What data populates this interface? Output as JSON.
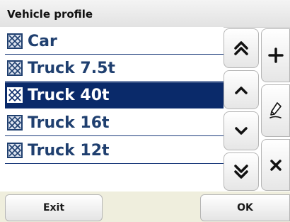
{
  "window": {
    "title": "Vehicle profile"
  },
  "vehicles": [
    {
      "label": "Car",
      "selected": false,
      "icon": "vehicle-profile-icon"
    },
    {
      "label": "Truck 7.5t",
      "selected": false,
      "icon": "vehicle-profile-icon"
    },
    {
      "label": "Truck 40t",
      "selected": true,
      "icon": "vehicle-profile-icon"
    },
    {
      "label": "Truck 16t",
      "selected": false,
      "icon": "vehicle-profile-icon"
    },
    {
      "label": "Truck 12t",
      "selected": false,
      "icon": "vehicle-profile-icon"
    }
  ],
  "scroll_buttons": {
    "page_up_icon": "double-chevron-up-icon",
    "up_icon": "chevron-up-icon",
    "down_icon": "chevron-down-icon",
    "page_down_icon": "double-chevron-down-icon"
  },
  "action_buttons": {
    "add_icon": "plus-icon",
    "edit_icon": "pen-icon",
    "delete_icon": "cross-icon"
  },
  "bottom_bar": {
    "exit_label": "Exit",
    "ok_label": "OK"
  },
  "colors": {
    "selection": "#0a2a6a",
    "item_text": "#1f3f6f",
    "separator": "#1a3a7a",
    "bottom_bar": "#efeedd"
  }
}
